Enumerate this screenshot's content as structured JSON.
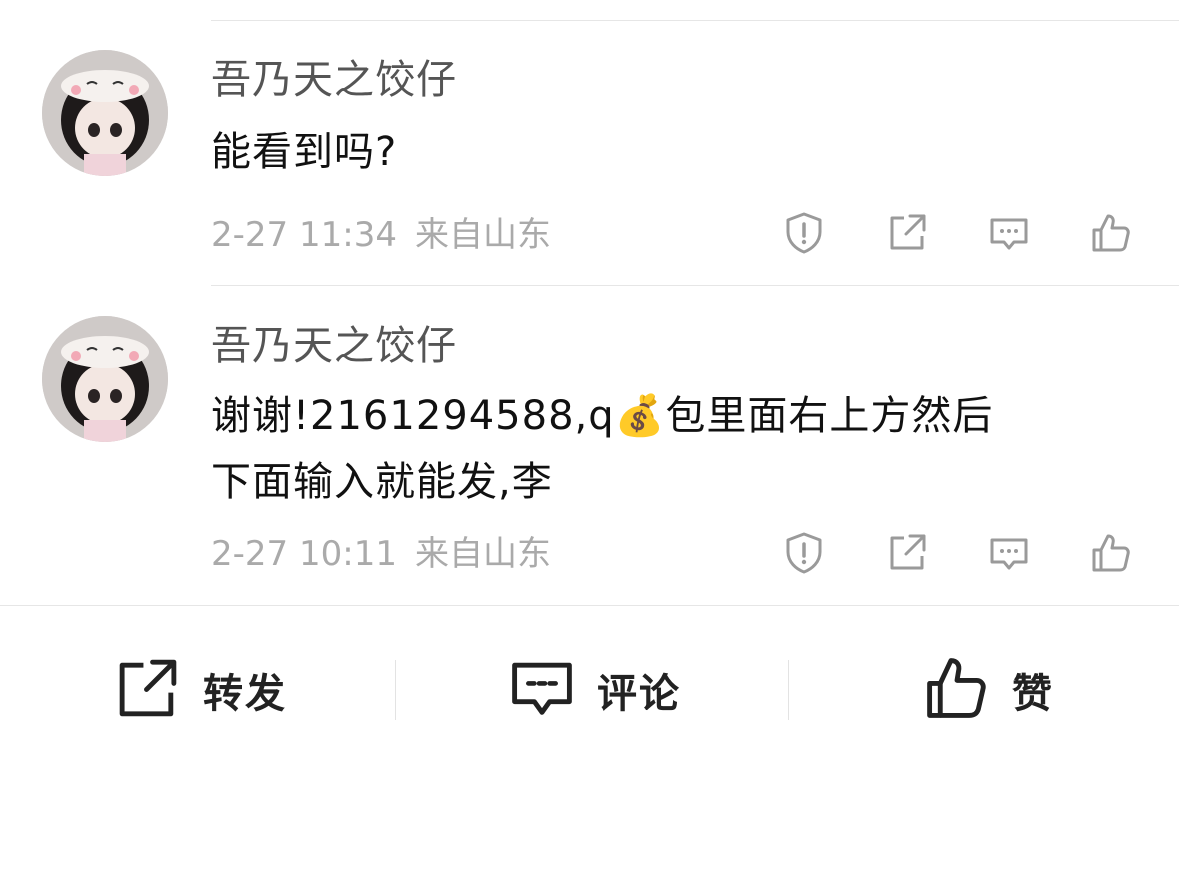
{
  "comments": [
    {
      "username": "吾乃天之饺仔",
      "content": "能看到吗?",
      "time": "2-27 11:34",
      "location": "来自山东"
    },
    {
      "username": "吾乃天之饺仔",
      "content_line1": "谢谢!2161294588,q💰包里面右上方然后",
      "content_line2": "下面输入就能发,李",
      "time": "2-27 10:11",
      "location": "来自山东"
    }
  ],
  "bottom_bar": {
    "repost_label": "转发",
    "comment_label": "评论",
    "like_label": "赞"
  },
  "icons": {
    "report": "shield-alert-icon",
    "share": "share-icon",
    "reply": "comment-bubble-icon",
    "like": "thumbs-up-icon"
  },
  "colors": {
    "text_primary": "#111111",
    "text_secondary": "#555555",
    "text_meta": "#aaaaaa",
    "icon_gray": "#9a9a9a",
    "icon_dark": "#222222",
    "divider": "#e6e6e6"
  }
}
